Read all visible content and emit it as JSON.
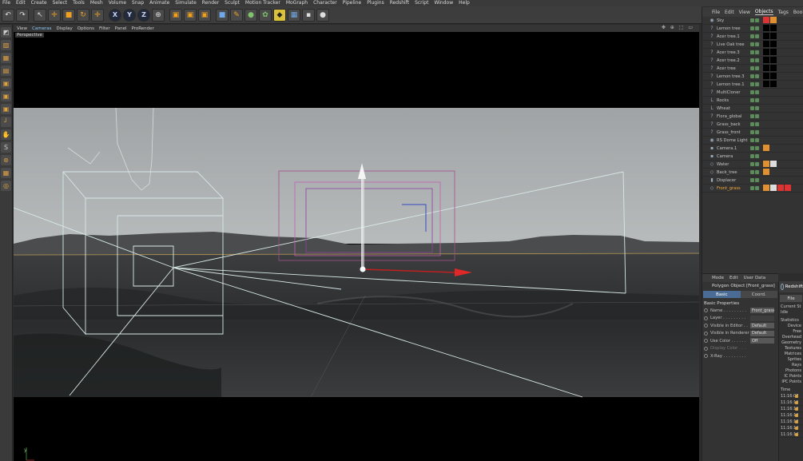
{
  "menubar": [
    "File",
    "Edit",
    "Create",
    "Select",
    "Tools",
    "Mesh",
    "Volume",
    "Snap",
    "Animate",
    "Simulate",
    "Render",
    "Sculpt",
    "Motion Tracker",
    "MoGraph",
    "Character",
    "Pipeline",
    "Plugins",
    "Redshift",
    "Script",
    "Window",
    "Help"
  ],
  "toolbar": {
    "buttons": [
      {
        "icon": "undo-icon",
        "glyph": "↶"
      },
      {
        "icon": "redo-icon",
        "glyph": "↷"
      },
      {
        "icon": "live-selection-icon",
        "glyph": "↖"
      },
      {
        "icon": "move-icon",
        "glyph": "✛"
      },
      {
        "icon": "scale-icon",
        "glyph": "■"
      },
      {
        "icon": "rotate-icon",
        "glyph": "↻"
      },
      {
        "icon": "recent-tool-icon",
        "glyph": "✛"
      },
      {
        "icon": "x-axis-icon",
        "glyph": "X"
      },
      {
        "icon": "y-axis-icon",
        "glyph": "Y"
      },
      {
        "icon": "z-axis-icon",
        "glyph": "Z"
      },
      {
        "icon": "coordinate-system-icon",
        "glyph": "⊕"
      },
      {
        "icon": "render-view-icon",
        "glyph": "▣"
      },
      {
        "icon": "render-picture-viewer-icon",
        "glyph": "▣"
      },
      {
        "icon": "edit-render-settings-icon",
        "glyph": "▣"
      },
      {
        "icon": "cube-icon",
        "glyph": "■"
      },
      {
        "icon": "pen-icon",
        "glyph": "✎"
      },
      {
        "icon": "subdivision-icon",
        "glyph": "●"
      },
      {
        "icon": "cloner-icon",
        "glyph": "✿"
      },
      {
        "icon": "deformer-icon",
        "glyph": "◆"
      },
      {
        "icon": "floor-icon",
        "glyph": "▦"
      },
      {
        "icon": "camera-icon",
        "glyph": "▪"
      },
      {
        "icon": "light-icon",
        "glyph": "●"
      }
    ]
  },
  "left_palette": [
    {
      "icon": "make-editable-icon",
      "glyph": "◩"
    },
    {
      "icon": "model-mode-icon",
      "glyph": "▨"
    },
    {
      "icon": "texture-mode-icon",
      "glyph": "▦"
    },
    {
      "icon": "workplane-icon",
      "glyph": "▤"
    },
    {
      "icon": "points-mode-icon",
      "glyph": "▣"
    },
    {
      "icon": "edges-mode-icon",
      "glyph": "▣"
    },
    {
      "icon": "polygons-mode-icon",
      "glyph": "▣"
    },
    {
      "icon": "axis-mode-icon",
      "glyph": "┘"
    },
    {
      "icon": "tweak-mode-icon",
      "glyph": "✋"
    },
    {
      "icon": "snap-icon",
      "glyph": "S"
    },
    {
      "icon": "lock-workplane-icon",
      "glyph": "⊛"
    },
    {
      "icon": "planar-workplane-icon",
      "glyph": "▦"
    },
    {
      "icon": "magnet-icon",
      "glyph": "◎"
    }
  ],
  "viewport": {
    "menu": [
      "View",
      "Cameras",
      "Display",
      "Options",
      "Filter",
      "Panel",
      "ProRender"
    ],
    "active_menu": "Cameras",
    "nav_icons": "✥ ⊕ ⬚ ▭",
    "label": "Perspective"
  },
  "object_manager": {
    "menu": [
      "File",
      "Edit",
      "View",
      "Objects",
      "Tags",
      "Bookm"
    ],
    "active_menu": "Objects",
    "rows": [
      {
        "name": "Sky",
        "icon": "sky-icon",
        "glyph": "◉",
        "tags": [
          "r",
          "o"
        ]
      },
      {
        "name": "Lemon tree",
        "icon": "object-icon",
        "glyph": "?",
        "tags": []
      },
      {
        "name": "Acer tree.1",
        "icon": "object-icon",
        "glyph": "?",
        "tags": []
      },
      {
        "name": "Live Oak tree",
        "icon": "object-icon",
        "glyph": "?",
        "tags": []
      },
      {
        "name": "Acer tree.3",
        "icon": "object-icon",
        "glyph": "?",
        "tags": []
      },
      {
        "name": "Acer tree.2",
        "icon": "object-icon",
        "glyph": "?",
        "tags": []
      },
      {
        "name": "Acer tree",
        "icon": "object-icon",
        "glyph": "?",
        "tags": []
      },
      {
        "name": "Lemon tree.3",
        "icon": "object-icon",
        "glyph": "?",
        "tags": []
      },
      {
        "name": "Lemon tree.1",
        "icon": "object-icon",
        "glyph": "?",
        "tags": []
      },
      {
        "name": "MultiCloner",
        "icon": "object-icon",
        "glyph": "?",
        "tags": []
      },
      {
        "name": "Rocks",
        "icon": "null-icon",
        "glyph": "L",
        "tags": []
      },
      {
        "name": "Wheat",
        "icon": "null-icon",
        "glyph": "L",
        "tags": []
      },
      {
        "name": "Flora_global",
        "icon": "object-icon",
        "glyph": "?",
        "tags": []
      },
      {
        "name": "Grass_back",
        "icon": "object-icon",
        "glyph": "?",
        "tags": []
      },
      {
        "name": "Grass_front",
        "icon": "object-icon",
        "glyph": "?",
        "tags": []
      },
      {
        "name": "RS Dome Light",
        "icon": "dome-light-icon",
        "glyph": "◉",
        "tags": []
      },
      {
        "name": "Camera.1",
        "icon": "camera-icon",
        "glyph": "▪",
        "tags": [
          "o"
        ]
      },
      {
        "name": "Camera",
        "icon": "camera-icon",
        "glyph": "▪",
        "tags": []
      },
      {
        "name": "Water",
        "icon": "plane-icon",
        "glyph": "◇",
        "tags": [
          "o",
          "w"
        ]
      },
      {
        "name": "Back_tree",
        "icon": "plane-icon",
        "glyph": "◇",
        "tags": [
          "o"
        ]
      },
      {
        "name": "Displacer",
        "icon": "displacer-icon",
        "glyph": "▮",
        "tags": []
      },
      {
        "name": "Front_grass",
        "icon": "plane-icon",
        "glyph": "◇",
        "tags": [
          "o",
          "w",
          "r",
          "r"
        ],
        "active": true
      }
    ]
  },
  "attribute_manager": {
    "menu": [
      "Mode",
      "Edit",
      "User Data"
    ],
    "title": "Polygon Object [Front_grass]",
    "tabs": [
      "Basic",
      "Coord."
    ],
    "active_tab": "Basic",
    "section": "Basic Properties",
    "props": [
      {
        "label": "Name . . . . . . . . .",
        "value": "Front_grass",
        "disabled": false
      },
      {
        "label": "Layer . . . . . . . . .",
        "value": "",
        "disabled": false
      },
      {
        "label": "Visible in Editor . .",
        "value": "Default",
        "disabled": false
      },
      {
        "label": "Visible in Renderer",
        "value": "Default",
        "disabled": false
      },
      {
        "label": "Use Color . . . . . .",
        "value": "Off",
        "disabled": false
      },
      {
        "label": "Display Color . . .",
        "value": "",
        "disabled": true
      },
      {
        "label": "X-Ray . . . . . . . . .",
        "value": "",
        "disabled": false
      }
    ]
  },
  "redshift_panel": {
    "title": "Redshift",
    "file_button": "File",
    "lines": [
      "Current St",
      "Idle"
    ],
    "stats_title": "Statistics",
    "stats": [
      "Device",
      "Free",
      "Overhead",
      "Geometry",
      "Textures",
      "Matrices",
      "Sprites",
      "Rays",
      "Photons",
      "IC Points",
      "IPC Points"
    ],
    "time_header": "Time",
    "times": [
      "11:16:07",
      "11:16:12",
      "11:16:12",
      "11:16:13",
      "11:16:13",
      "11:16:14",
      "11:16:14"
    ]
  }
}
